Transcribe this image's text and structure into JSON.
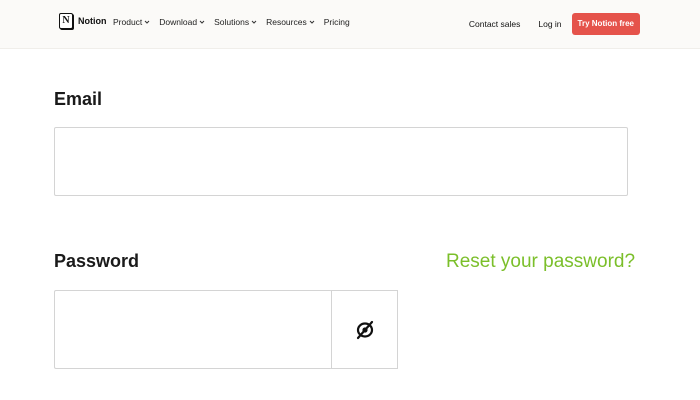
{
  "nav": {
    "logo_text": "Notion",
    "logo_mark": "N",
    "links": [
      {
        "label": "Product",
        "has_dropdown": true
      },
      {
        "label": "Download",
        "has_dropdown": true
      },
      {
        "label": "Solutions",
        "has_dropdown": true
      },
      {
        "label": "Resources",
        "has_dropdown": true
      },
      {
        "label": "Pricing",
        "has_dropdown": false
      }
    ],
    "contact_sales": "Contact sales",
    "login": "Log in",
    "cta": "Try Notion free",
    "cta_color": "#e5534b"
  },
  "form": {
    "email_label": "Email",
    "email_value": "",
    "password_label": "Password",
    "password_value": "",
    "reset_link": "Reset your password?",
    "reset_color": "#7bbf2a",
    "toggle_icon": "eye-slash-icon"
  }
}
